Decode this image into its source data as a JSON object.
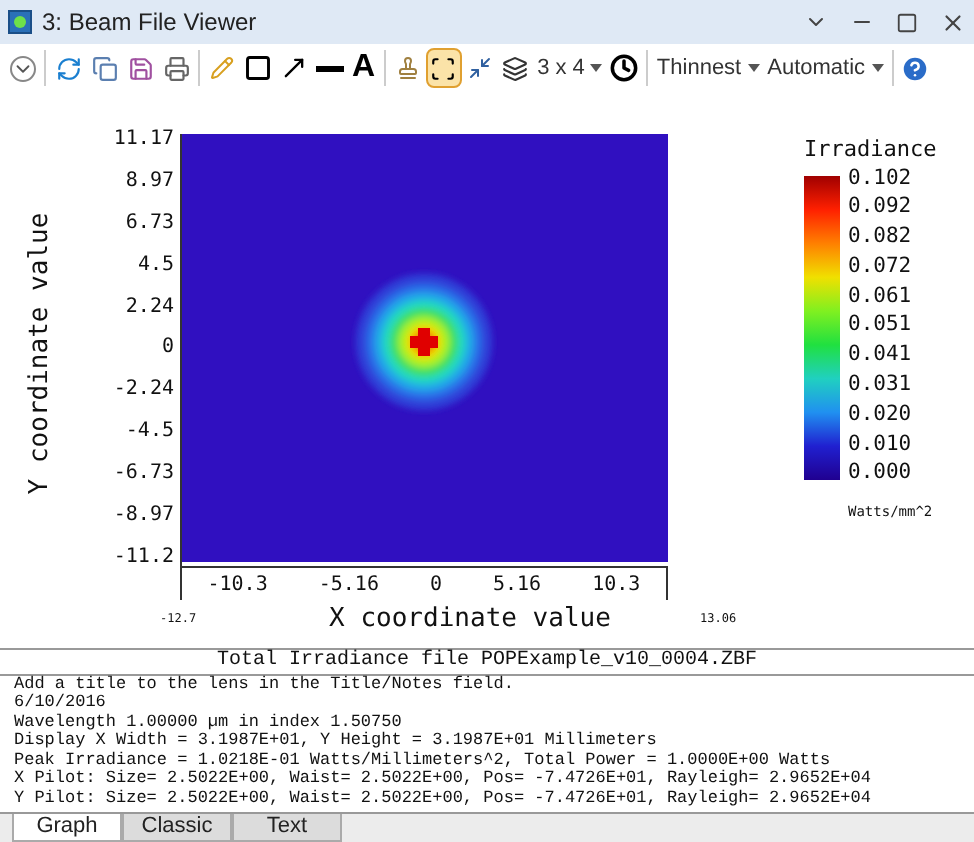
{
  "window": {
    "title": "3: Beam File Viewer"
  },
  "toolbar": {
    "text_tool": "A",
    "fit_toggle": {
      "selected": true
    },
    "layout": "3 x 4",
    "line_style": "Thinnest",
    "scale": "Automatic"
  },
  "plot": {
    "ylabel": "Y coordinate value",
    "xlabel": "X coordinate value",
    "yticks": [
      "11.17",
      "8.97",
      "6.73",
      "4.5",
      "2.24",
      "0",
      "-2.24",
      "-4.5",
      "-6.73",
      "-8.97",
      "-11.2"
    ],
    "xticks": [
      "-10.3",
      "-5.16",
      "0",
      "5.16",
      "10.3"
    ],
    "x_min": "-12.7",
    "x_max": "13.06"
  },
  "legend": {
    "title": "Irradiance",
    "ticks": [
      "0.102",
      "0.092",
      "0.082",
      "0.072",
      "0.061",
      "0.051",
      "0.041",
      "0.031",
      "0.020",
      "0.010",
      "0.000"
    ],
    "unit": "Watts/mm^2"
  },
  "text_panel": {
    "header": "Total Irradiance file POPExample_v10_0004.ZBF",
    "lines": [
      "Add a title to the lens in the Title/Notes field.",
      "6/10/2016",
      "Wavelength 1.00000 µm in index 1.50750",
      "Display X Width = 3.1987E+01, Y Height = 3.1987E+01 Millimeters",
      "Peak Irradiance = 1.0218E-01 Watts/Millimeters^2, Total Power = 1.0000E+00 Watts",
      "X Pilot: Size= 2.5022E+00, Waist= 2.5022E+00, Pos= -7.4726E+01, Rayleigh= 2.9652E+04",
      "Y Pilot: Size= 2.5022E+00, Waist= 2.5022E+00, Pos= -7.4726E+01, Rayleigh= 2.9652E+04"
    ]
  },
  "tabs": [
    {
      "label": "Graph",
      "selected": true
    },
    {
      "label": "Classic",
      "selected": false
    },
    {
      "label": "Text",
      "selected": false
    }
  ]
}
